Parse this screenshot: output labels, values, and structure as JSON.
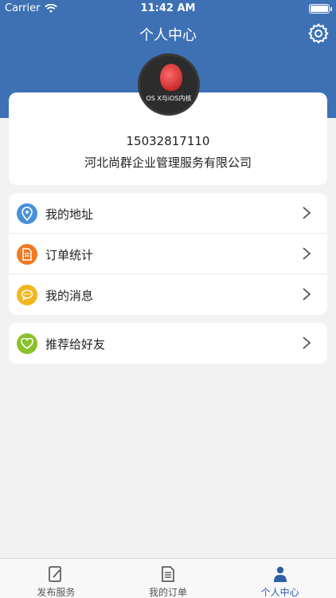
{
  "status": {
    "carrier": "Carrier",
    "time": "11:42 AM"
  },
  "nav": {
    "title": "个人中心",
    "settings_icon": "gear-icon"
  },
  "profile": {
    "avatar_text": "OS X与iOS内核",
    "phone": "15032817110",
    "company": "河北尚群企业管理服务有限公司"
  },
  "menu": [
    {
      "label": "我的地址",
      "icon": "location-icon",
      "color": "#4a90d9"
    },
    {
      "label": "订单统计",
      "icon": "document-icon",
      "color": "#f07a21"
    },
    {
      "label": "我的消息",
      "icon": "message-icon",
      "color": "#f2b61c"
    }
  ],
  "menu2": [
    {
      "label": "推荐给好友",
      "icon": "heart-icon",
      "color": "#8bc22b"
    }
  ],
  "tabs": [
    {
      "label": "发布服务",
      "icon": "edit-icon"
    },
    {
      "label": "我的订单",
      "icon": "order-icon"
    },
    {
      "label": "个人中心",
      "icon": "user-icon",
      "active": true
    }
  ],
  "colors": {
    "header": "#3d71b4",
    "accent": "#2f5fa6"
  }
}
